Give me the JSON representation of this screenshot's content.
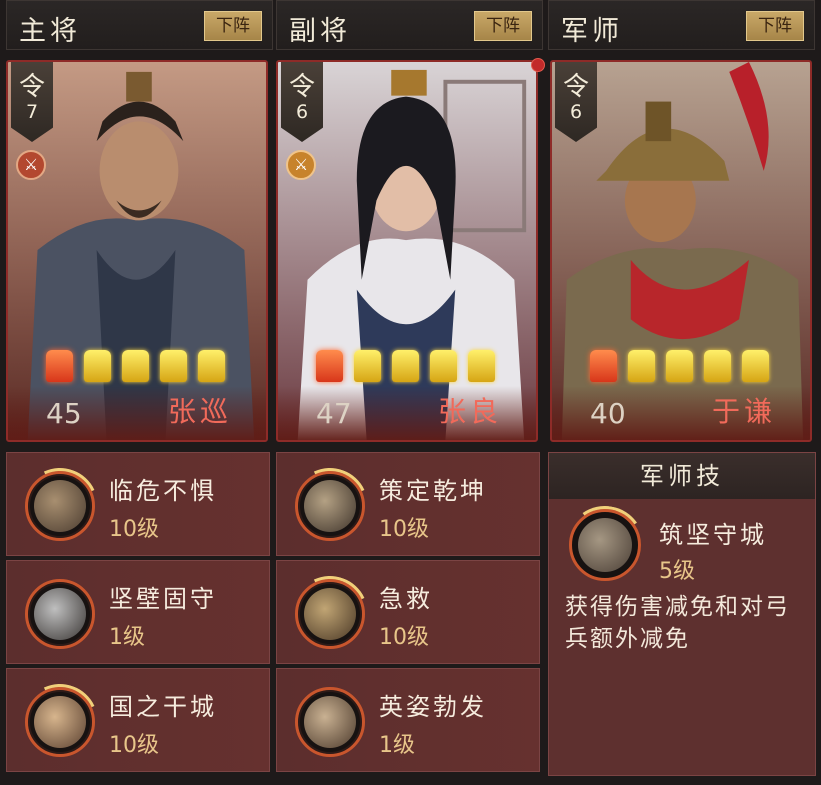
{
  "columns": [
    {
      "title": "主将",
      "button": "下阵",
      "command_char": "令",
      "command_value": "7",
      "weapon_icon": "knife-icon",
      "level": "45",
      "name": "张巡",
      "stars": [
        "red",
        "gold",
        "gold",
        "gold",
        "gold"
      ],
      "skills": [
        {
          "name": "临危不惧",
          "level": "10级"
        },
        {
          "name": "坚壁固守",
          "level": "1级"
        },
        {
          "name": "国之干城",
          "level": "10级"
        }
      ]
    },
    {
      "title": "副将",
      "button": "下阵",
      "command_char": "令",
      "command_value": "6",
      "weapon_icon": "knife-icon",
      "level": "47",
      "name": "张良",
      "stars": [
        "red",
        "gold",
        "gold",
        "gold",
        "gold"
      ],
      "skills": [
        {
          "name": "策定乾坤",
          "level": "10级"
        },
        {
          "name": "急救",
          "level": "10级"
        },
        {
          "name": "英姿勃发",
          "level": "1级"
        }
      ]
    },
    {
      "title": "军师",
      "button": "下阵",
      "command_char": "令",
      "command_value": "6",
      "level": "40",
      "name": "于谦",
      "stars": [
        "red",
        "gold",
        "gold",
        "gold",
        "gold"
      ]
    }
  ],
  "advisor_skill": {
    "header": "军师技",
    "name": "筑坚守城",
    "level": "5级",
    "description": "获得伤害减免和对弓兵额外减免"
  },
  "colors": {
    "accent_gold": "#c9a868",
    "name_red": "#f16a5a",
    "panel": "#5e302f"
  }
}
